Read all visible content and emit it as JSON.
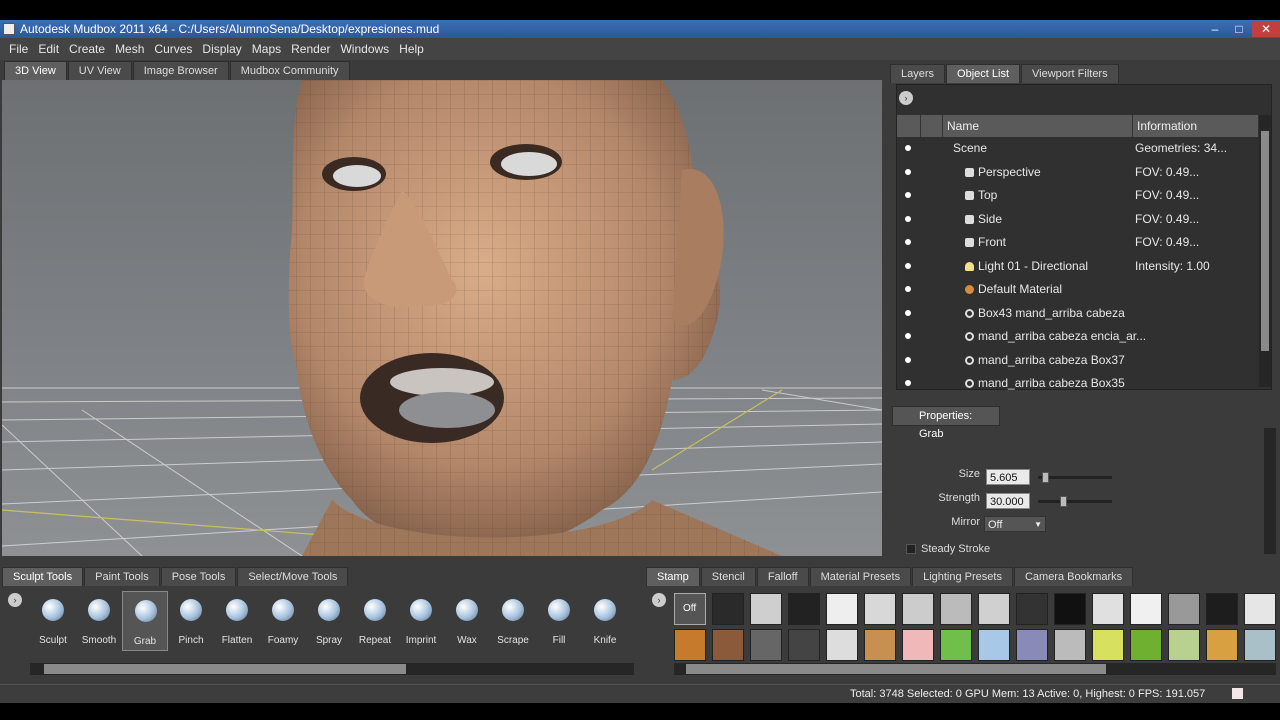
{
  "window": {
    "title": "Autodesk Mudbox 2011 x64 - C:/Users/AlumnoSena/Desktop/expresiones.mud",
    "min": "–",
    "max": "□",
    "close": "✕"
  },
  "menu": [
    "File",
    "Edit",
    "Create",
    "Mesh",
    "Curves",
    "Display",
    "Maps",
    "Render",
    "Windows",
    "Help"
  ],
  "viewport_tabs": [
    "3D View",
    "UV View",
    "Image Browser",
    "Mudbox Community"
  ],
  "right_tabs": [
    "Layers",
    "Object List",
    "Viewport Filters"
  ],
  "object_list": {
    "columns": [
      "Name",
      "Information"
    ],
    "rows": [
      {
        "name": "Scene",
        "info": "Geometries: 34...",
        "icon": "none",
        "indent": 0
      },
      {
        "name": "Perspective",
        "info": "FOV: 0.49...",
        "icon": "camera-icon",
        "indent": 1
      },
      {
        "name": "Top",
        "info": "FOV: 0.49...",
        "icon": "camera-icon",
        "indent": 1
      },
      {
        "name": "Side",
        "info": "FOV: 0.49...",
        "icon": "camera-icon",
        "indent": 1
      },
      {
        "name": "Front",
        "info": "FOV: 0.49...",
        "icon": "camera-icon",
        "indent": 1
      },
      {
        "name": "Light 01 - Directional",
        "info": "Intensity: 1.00",
        "icon": "light-icon",
        "indent": 1
      },
      {
        "name": "Default Material",
        "info": "",
        "icon": "material-icon",
        "indent": 1
      },
      {
        "name": "Box43 mand_arriba cabeza",
        "info": "",
        "icon": "geometry-icon",
        "indent": 1
      },
      {
        "name": "mand_arriba cabeza encia_ar...",
        "info": "",
        "icon": "geometry-icon",
        "indent": 1
      },
      {
        "name": "mand_arriba cabeza Box37",
        "info": "",
        "icon": "geometry-icon",
        "indent": 1
      },
      {
        "name": "mand_arriba cabeza Box35",
        "info": "",
        "icon": "geometry-icon",
        "indent": 1
      }
    ]
  },
  "properties": {
    "title": "Properties: Grab",
    "size_label": "Size",
    "size_value": "5.605",
    "size_level": 0.05,
    "strength_label": "Strength",
    "strength_value": "30.000",
    "strength_level": 0.3,
    "mirror_label": "Mirror",
    "mirror_value": "Off",
    "steady_label": "Steady Stroke"
  },
  "tool_tabs": [
    "Sculpt Tools",
    "Paint Tools",
    "Pose Tools",
    "Select/Move Tools"
  ],
  "tools": [
    "Sculpt",
    "Smooth",
    "Grab",
    "Pinch",
    "Flatten",
    "Foamy",
    "Spray",
    "Repeat",
    "Imprint",
    "Wax",
    "Scrape",
    "Fill",
    "Knife"
  ],
  "active_tool": "Grab",
  "stamp_tabs": [
    "Stamp",
    "Stencil",
    "Falloff",
    "Material Presets",
    "Lighting Presets",
    "Camera Bookmarks"
  ],
  "stamp_off_label": "Off",
  "status": "Total: 3748  Selected: 0 GPU Mem: 13  Active: 0, Highest: 0  FPS: 191.057",
  "colors": {
    "titlebar": "#2a5899",
    "panel": "#3b3b3b",
    "skin": "#b58c6c"
  }
}
